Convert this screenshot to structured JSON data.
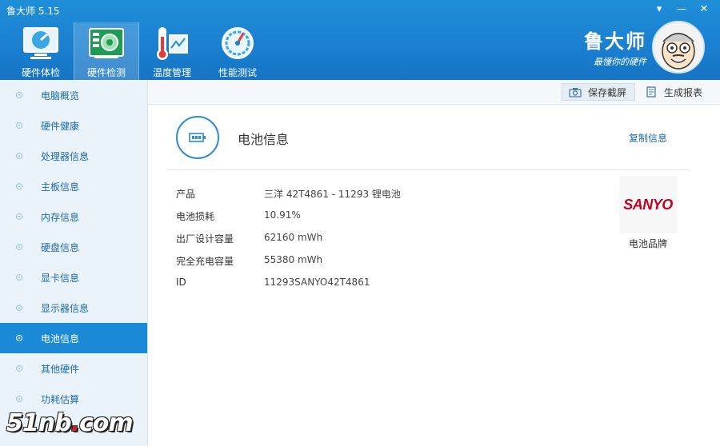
{
  "window": {
    "title": "鲁大师 5.15",
    "controls": [
      "▾",
      "—",
      "✕"
    ]
  },
  "nav": {
    "tabs": [
      {
        "label": "硬件体检",
        "icon": "monitor-icon"
      },
      {
        "label": "硬件检测",
        "icon": "circuit-board-icon"
      },
      {
        "label": "温度管理",
        "icon": "thermometer-icon"
      },
      {
        "label": "性能测试",
        "icon": "speedometer-icon"
      }
    ],
    "active_index": 1
  },
  "brand": {
    "name": "鲁大师",
    "slogan": "最懂你的硬件"
  },
  "sidebar": {
    "items": [
      {
        "label": "电脑概览"
      },
      {
        "label": "硬件健康"
      },
      {
        "label": "处理器信息"
      },
      {
        "label": "主板信息"
      },
      {
        "label": "内存信息"
      },
      {
        "label": "硬盘信息"
      },
      {
        "label": "显卡信息"
      },
      {
        "label": "显示器信息"
      },
      {
        "label": "电池信息"
      },
      {
        "label": "其他硬件"
      },
      {
        "label": "功耗估算"
      }
    ],
    "active_index": 8
  },
  "toolbar": {
    "save_label": "保存截屏",
    "report_label": "生成报表"
  },
  "battery": {
    "section_title": "电池信息",
    "copy_label": "复制信息",
    "rows": [
      {
        "label": "产品",
        "value": "三洋 42T4861 - 11293 锂电池"
      },
      {
        "label": "电池损耗",
        "value": "10.91%"
      },
      {
        "label": "出厂设计容量",
        "value": "62160 mWh"
      },
      {
        "label": "完全充电容量",
        "value": "55380 mWh"
      },
      {
        "label": "ID",
        "value": "11293SANYO42T4861"
      }
    ],
    "brand_logo": "SANYO",
    "brand_caption": "电池品牌"
  },
  "watermark": {
    "prefix": "51nb",
    "dot": ".",
    "suffix": "com"
  },
  "colors": {
    "header_blue": "#1a7fcf",
    "sidebar_active": "#1a8ad6",
    "link_blue": "#1d6aa6",
    "sanyo_red": "#c4001f"
  }
}
